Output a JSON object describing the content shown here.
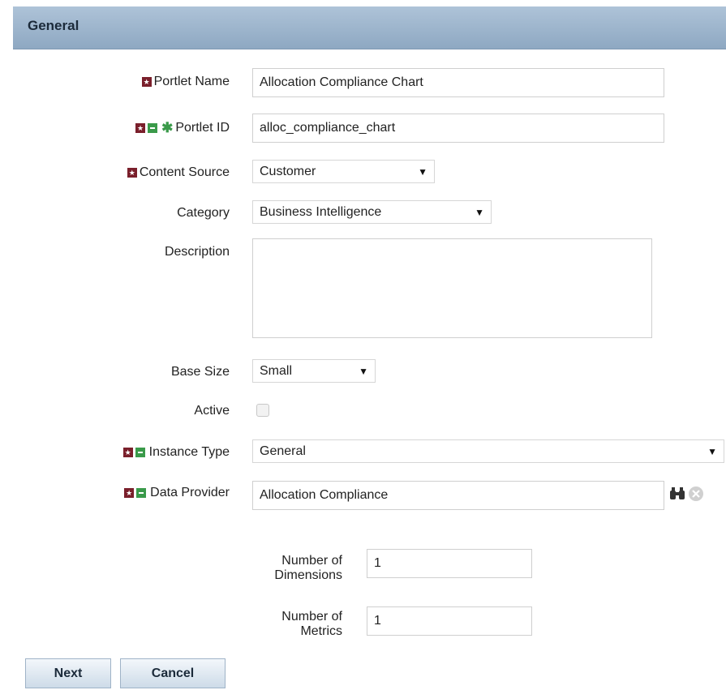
{
  "section": {
    "title": "General"
  },
  "fields": {
    "portlet_name": {
      "label": "Portlet Name",
      "value": "Allocation Compliance Chart"
    },
    "portlet_id": {
      "label": "Portlet ID",
      "value": "alloc_compliance_chart"
    },
    "content_source": {
      "label": "Content Source",
      "value": "Customer"
    },
    "category": {
      "label": "Category",
      "value": "Business Intelligence"
    },
    "description": {
      "label": "Description",
      "value": ""
    },
    "base_size": {
      "label": "Base Size",
      "value": "Small"
    },
    "active": {
      "label": "Active",
      "checked": false
    },
    "instance_type": {
      "label": "Instance Type",
      "value": "General"
    },
    "data_provider": {
      "label": "Data Provider",
      "value": "Allocation Compliance"
    },
    "num_dimensions": {
      "label_line1": "Number of",
      "label_line2": "Dimensions",
      "value": "1"
    },
    "num_metrics": {
      "label_line1": "Number of",
      "label_line2": "Metrics",
      "value": "1"
    }
  },
  "buttons": {
    "next": "Next",
    "cancel": "Cancel"
  },
  "icons": {
    "required": "star-box-icon",
    "translatable": "green-box-icon",
    "unique": "asterisk-icon",
    "lookup": "binoculars-icon",
    "clear": "clear-circle-icon"
  },
  "colors": {
    "header": "#9fb6cd",
    "required": "#7a1f2b",
    "green": "#3a9a4a"
  }
}
